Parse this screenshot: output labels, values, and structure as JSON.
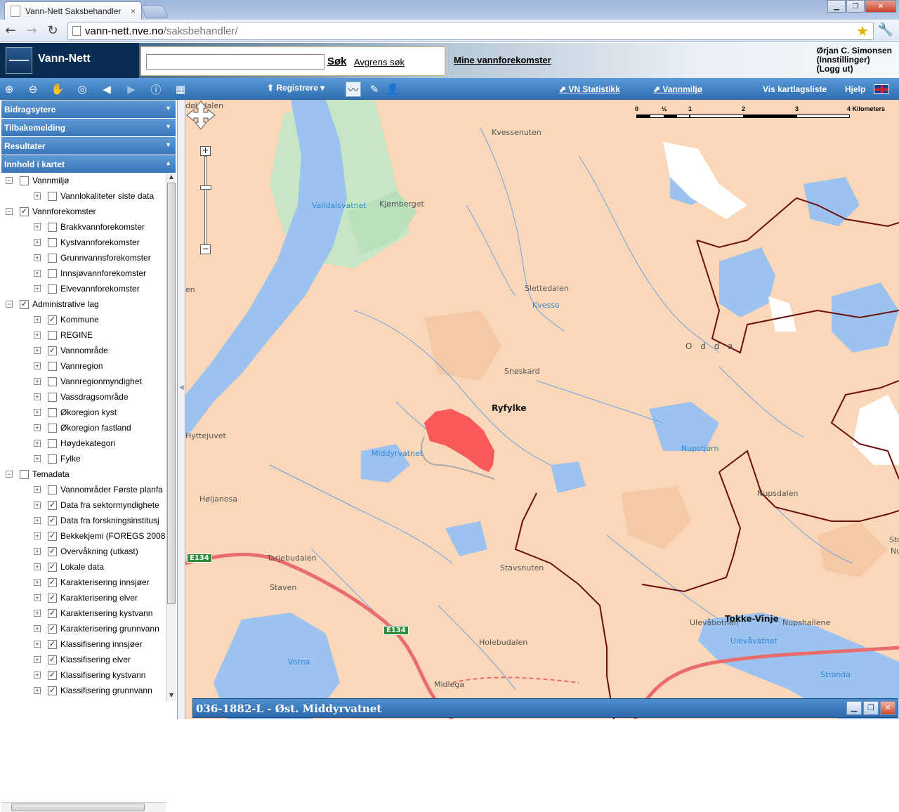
{
  "browser": {
    "tab_title": "Vann-Nett Saksbehandler",
    "tab_close": "×",
    "url_host": "vann-nett.nve.no",
    "url_path": "/saksbehandler/",
    "window_controls": {
      "minimize": "▁",
      "maximize": "❐",
      "close": "✕"
    }
  },
  "header": {
    "app_title": "Vann-Nett",
    "search_placeholder": "",
    "search_button": "Søk",
    "refine_link": "Avgrens søk",
    "mine_link": "Mine vannforekomster",
    "user_name": "Ørjan C. Simonsen",
    "user_settings": "(Innstillinger)",
    "user_logout": "(Logg ut)"
  },
  "toolbar": {
    "register_label": "Registrere",
    "links": {
      "vn_stat": "VN Statistikk",
      "vannmiljo": "Vannmiljø",
      "kartlag": "Vis kartlagsliste",
      "help": "Hjelp"
    }
  },
  "sidebar": {
    "accordion": [
      {
        "label": "Bidragsytere",
        "arrow": "▼"
      },
      {
        "label": "Tilbakemelding",
        "arrow": "▼"
      },
      {
        "label": "Resultater",
        "arrow": "▼"
      },
      {
        "label": "Innhold i kartet",
        "arrow": "▲"
      }
    ],
    "tree": [
      {
        "level": 0,
        "expander": "−",
        "checked": false,
        "label": "Vannmiljø"
      },
      {
        "level": 1,
        "expander": "+",
        "checked": false,
        "label": "Vannlokaliteter siste data"
      },
      {
        "level": 0,
        "expander": "−",
        "checked": true,
        "label": "Vannforekomster"
      },
      {
        "level": 1,
        "expander": "+",
        "checked": false,
        "label": "Brakkvannforekomster"
      },
      {
        "level": 1,
        "expander": "+",
        "checked": false,
        "label": "Kystvannforekomster"
      },
      {
        "level": 1,
        "expander": "+",
        "checked": false,
        "label": "Grunnvannsforekomster"
      },
      {
        "level": 1,
        "expander": "+",
        "checked": false,
        "label": "Innsjøvannforekomster"
      },
      {
        "level": 1,
        "expander": "+",
        "checked": false,
        "label": "Elvevannforekomster"
      },
      {
        "level": 0,
        "expander": "−",
        "checked": true,
        "label": "Administrative lag"
      },
      {
        "level": 1,
        "expander": "+",
        "checked": true,
        "label": "Kommune"
      },
      {
        "level": 1,
        "expander": "+",
        "checked": false,
        "label": "REGINE"
      },
      {
        "level": 1,
        "expander": "+",
        "checked": true,
        "label": "Vannområde"
      },
      {
        "level": 1,
        "expander": "+",
        "checked": false,
        "label": "Vannregion"
      },
      {
        "level": 1,
        "expander": "+",
        "checked": false,
        "label": "Vannregionmyndighet"
      },
      {
        "level": 1,
        "expander": "+",
        "checked": false,
        "label": "Vassdragsområde"
      },
      {
        "level": 1,
        "expander": "+",
        "checked": false,
        "label": "Økoregion kyst"
      },
      {
        "level": 1,
        "expander": "+",
        "checked": false,
        "label": "Økoregion fastland"
      },
      {
        "level": 1,
        "expander": "+",
        "checked": false,
        "label": "Høydekategori"
      },
      {
        "level": 1,
        "expander": "+",
        "checked": false,
        "label": "Fylke"
      },
      {
        "level": 0,
        "expander": "−",
        "checked": false,
        "label": "Temadata"
      },
      {
        "level": 1,
        "expander": "+",
        "checked": false,
        "label": "Vannområder Første planfa"
      },
      {
        "level": 1,
        "expander": "+",
        "checked": true,
        "label": "Data fra sektormyndighete"
      },
      {
        "level": 1,
        "expander": "+",
        "checked": true,
        "label": "Data fra forskningsinstitusj"
      },
      {
        "level": 1,
        "expander": "+",
        "checked": true,
        "label": "Bekkekjemi (FOREGS 2008"
      },
      {
        "level": 1,
        "expander": "+",
        "checked": true,
        "label": "Overvåkning (utkast)"
      },
      {
        "level": 1,
        "expander": "+",
        "checked": true,
        "label": "Lokale data"
      },
      {
        "level": 1,
        "expander": "+",
        "checked": true,
        "label": "Karakterisering innsjøer"
      },
      {
        "level": 1,
        "expander": "+",
        "checked": true,
        "label": "Karakterisering elver"
      },
      {
        "level": 1,
        "expander": "+",
        "checked": true,
        "label": "Karakterisering kystvann"
      },
      {
        "level": 1,
        "expander": "+",
        "checked": true,
        "label": "Karakterisering grunnvann"
      },
      {
        "level": 1,
        "expander": "+",
        "checked": true,
        "label": "Klassifisering innsjøer"
      },
      {
        "level": 1,
        "expander": "+",
        "checked": true,
        "label": "Klassifisering elver"
      },
      {
        "level": 1,
        "expander": "+",
        "checked": true,
        "label": "Klassifisering kystvann"
      },
      {
        "level": 1,
        "expander": "+",
        "checked": true,
        "label": "Klassifisering grunnvann"
      }
    ]
  },
  "map": {
    "labels": [
      {
        "text": "døledalen",
        "kind": "plain"
      },
      {
        "text": "Kvessenuten",
        "kind": "plain"
      },
      {
        "text": "Valldalsvatnet",
        "kind": "water"
      },
      {
        "text": "Kjømberget",
        "kind": "plain"
      },
      {
        "text": "en",
        "kind": "plain"
      },
      {
        "text": "Slettedalen",
        "kind": "plain"
      },
      {
        "text": "Kvesso",
        "kind": "water"
      },
      {
        "text": "O d d a",
        "kind": "big"
      },
      {
        "text": "Snøskard",
        "kind": "plain"
      },
      {
        "text": "Ryfylke",
        "kind": "bold"
      },
      {
        "text": "Hyttejuvet",
        "kind": "plain"
      },
      {
        "text": "Middyrvatnet",
        "kind": "water"
      },
      {
        "text": "Nupstjørn",
        "kind": "water"
      },
      {
        "text": "Nupsdalen",
        "kind": "plain"
      },
      {
        "text": "Høljanosa",
        "kind": "plain"
      },
      {
        "text": "Tarjebudalen",
        "kind": "plain"
      },
      {
        "text": "Stor",
        "kind": "plain"
      },
      {
        "text": "Nup",
        "kind": "plain"
      },
      {
        "text": "Staven",
        "kind": "plain"
      },
      {
        "text": "Stavsnuten",
        "kind": "plain"
      },
      {
        "text": "Ulevåbotnen",
        "kind": "plain"
      },
      {
        "text": "Tokke-Vinje",
        "kind": "bold"
      },
      {
        "text": "Nupshallene",
        "kind": "plain"
      },
      {
        "text": "Ulevåvatnet",
        "kind": "water"
      },
      {
        "text": "Holebudalen",
        "kind": "plain"
      },
      {
        "text": "Votna",
        "kind": "water"
      },
      {
        "text": "Stronda",
        "kind": "water"
      },
      {
        "text": "Midlega",
        "kind": "plain"
      }
    ],
    "road_shields": [
      "E134",
      "E134"
    ],
    "scale": [
      "0",
      "½",
      "1",
      "2",
      "3",
      "4 Kilometers"
    ],
    "info_title": "036-1882-L - Øst. Middyrvatnet",
    "colors": {
      "land": "#f9d7b8",
      "water": "#9cc3f0",
      "forest": "#c6e6c6",
      "selected": "#f85a5a",
      "boundary": "#6b0f0f",
      "road": "#e96d6d"
    }
  }
}
